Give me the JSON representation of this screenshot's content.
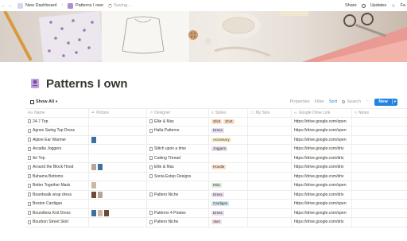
{
  "topbar": {
    "breadcrumb": [
      {
        "label": "New Dashboard",
        "icon": "dashboard-icon"
      },
      {
        "label": "Patterns I own",
        "icon": "page-icon"
      }
    ],
    "status": "Saving...",
    "actions": [
      "Share",
      "Updates",
      "Fa"
    ]
  },
  "page": {
    "title": "Patterns I own"
  },
  "view": {
    "label": "Show All",
    "tools": {
      "properties": "Properties",
      "filter": "Filter",
      "sort": "Sort",
      "search": "Search"
    },
    "new_button": "New"
  },
  "columns": [
    "Name",
    "Picture",
    "Designer",
    "Styles",
    "My Size",
    "Google Drive Link",
    "Notes"
  ],
  "rows": [
    {
      "name": "24-7 Top",
      "designer": "Ellie & Mac",
      "styles": [
        "Shirt",
        "Shirt"
      ],
      "link": "https://drive.google.com/open",
      "thumbs": 0
    },
    {
      "name": "Agnes Swing Top Dress",
      "designer": "Halla Patterns",
      "styles": [
        "Dress"
      ],
      "link": "https://drive.google.com/open",
      "thumbs": 0
    },
    {
      "name": "Alpine Ear Warmer",
      "designer": "",
      "styles": [
        "Accessory"
      ],
      "link": "https://drive.google.com/open",
      "thumbs": 1
    },
    {
      "name": "Arcadia Joggers",
      "designer": "Stitch upon a time",
      "styles": [
        "Joggers"
      ],
      "link": "https://drive.google.com/driv",
      "thumbs": 0
    },
    {
      "name": "Ari Top",
      "designer": "Cutting Thread",
      "styles": [],
      "link": "https://drive.google.com/driv",
      "thumbs": 0
    },
    {
      "name": "Around the Block Hood",
      "designer": "Ellie & Mac",
      "styles": [
        "Hoodie"
      ],
      "link": "https://drive.google.com/driv",
      "thumbs": 2
    },
    {
      "name": "Bahama Bottoms",
      "designer": "Sonia Estep Designs",
      "styles": [],
      "link": "https://drive.google.com/driv",
      "thumbs": 0
    },
    {
      "name": "Better Together Mask",
      "designer": "",
      "styles": [
        "Misc"
      ],
      "link": "https://drive.google.com/open",
      "thumbs": 1
    },
    {
      "name": "Boardwalk wrap dress",
      "designer": "Pattern Niche",
      "styles": [
        "Dress"
      ],
      "link": "https://drive.google.com/driv",
      "thumbs": 2
    },
    {
      "name": "Boston Cardigan",
      "designer": "",
      "styles": [
        "Cardigan"
      ],
      "link": "https://drive.google.com/open",
      "thumbs": 0
    },
    {
      "name": "Boundless Knit Dress",
      "designer": "Patterns 4 Pirates",
      "styles": [
        "Dress"
      ],
      "link": "https://drive.google.com/open",
      "thumbs": 3
    },
    {
      "name": "Bourbon Street Skirt",
      "designer": "Pattern Niche",
      "styles": [
        "Skirt"
      ],
      "link": "https://drive.google.com/driv",
      "thumbs": 0
    }
  ],
  "colors": {
    "accent": "#2383e2",
    "tag_shirt": "#fadec9",
    "tag_dress": "#e8deee",
    "tag_accessory": "#fbeecc",
    "tag_joggers": "#e8deee",
    "tag_hoodie": "#fadec9",
    "tag_misc": "#dbeddb",
    "tag_cardigan": "#d3e5ef",
    "tag_skirt": "#f5e0e9"
  }
}
